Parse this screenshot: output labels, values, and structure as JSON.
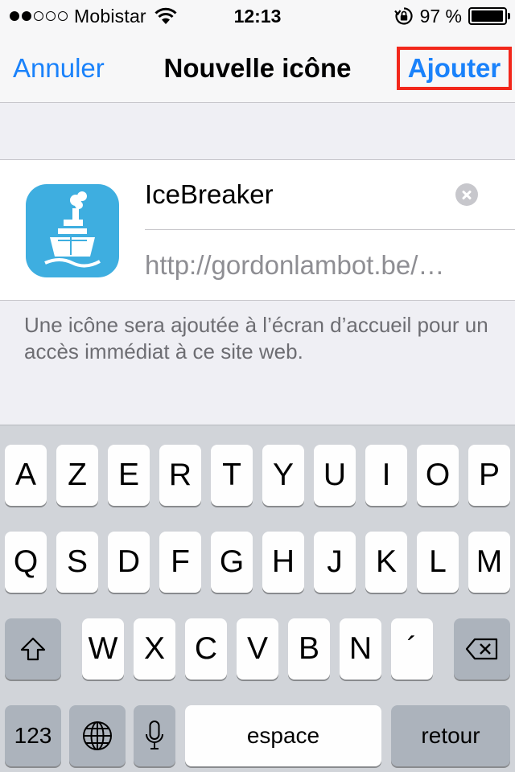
{
  "status_bar": {
    "carrier": "Mobistar",
    "signal_dots_filled": 2,
    "signal_dots_total": 5,
    "time": "12:13",
    "battery_percent_text": "97 %",
    "battery_level": 0.97,
    "icons": [
      "wifi-icon",
      "rotation-lock-icon",
      "battery-icon"
    ]
  },
  "nav": {
    "cancel_label": "Annuler",
    "title": "Nouvelle icône",
    "add_label": "Ajouter",
    "accent_color": "#1a82fb",
    "highlight_color": "#f2271b"
  },
  "form": {
    "app_icon": "icebreaker-ship-icon",
    "app_icon_color": "#3eaee0",
    "name_value": "IceBreaker",
    "url_value": "http://gordonlambot.be/…",
    "footer_note": "Une icône sera ajoutée à l’écran d’accueil pour un accès immédiat à ce site web."
  },
  "keyboard": {
    "row1": [
      "A",
      "Z",
      "E",
      "R",
      "T",
      "Y",
      "U",
      "I",
      "O",
      "P"
    ],
    "row2": [
      "Q",
      "S",
      "D",
      "F",
      "G",
      "H",
      "J",
      "K",
      "L",
      "M"
    ],
    "row3": [
      "W",
      "X",
      "C",
      "V",
      "B",
      "N",
      "´"
    ],
    "numbers_label": "123",
    "space_label": "espace",
    "return_label": "retour",
    "icons": [
      "shift-icon",
      "delete-icon",
      "globe-icon",
      "microphone-icon"
    ]
  }
}
